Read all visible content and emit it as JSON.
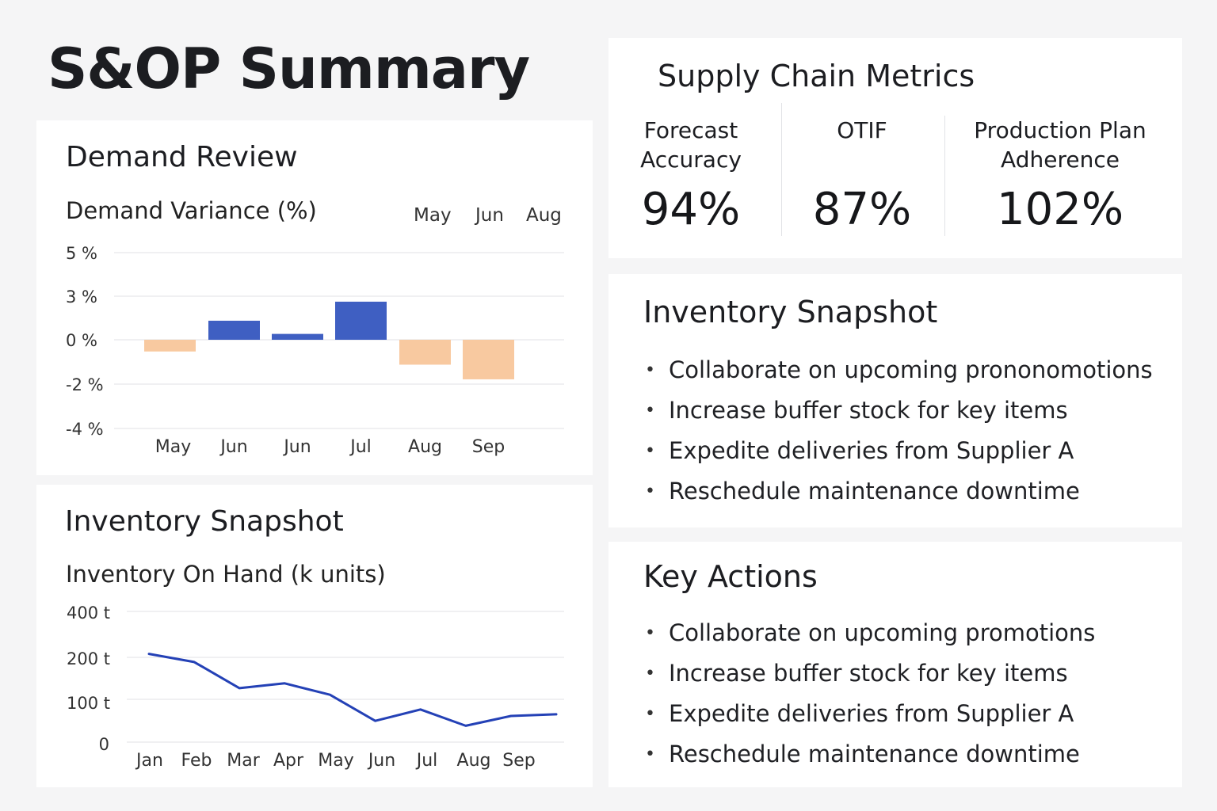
{
  "page": {
    "title": "S&OP Summary"
  },
  "demand_review": {
    "title": "Demand Review",
    "chart_title": "Demand Variance (%)",
    "header_months": [
      "May",
      "Jun",
      "Aug"
    ]
  },
  "inventory_chart_card": {
    "title": "Inventory Snapshot",
    "chart_title": "Inventory On Hand (k units)"
  },
  "metrics": {
    "title": "Supply Chain Metrics",
    "items": [
      {
        "label_line1": "Forecast",
        "label_line2": "Accuracy",
        "value": "94%"
      },
      {
        "label_line1": "OTIF",
        "label_line2": "",
        "value": "87%"
      },
      {
        "label_line1": "Production Plan",
        "label_line2": "Adherence",
        "value": "102%"
      }
    ]
  },
  "inventory_snapshot": {
    "title": "Inventory Snapshot",
    "items": [
      "Collaborate on upcoming prononomotions",
      "Increase buffer stock for key items",
      "Expedite deliveries from Supplier A",
      "Reschedule maintenance downtime"
    ]
  },
  "key_actions": {
    "title": "Key Actions",
    "items": [
      "Collaborate on upcoming promotions",
      "Increase buffer stock for key items",
      "Expedite deliveries from Supplier A",
      "Reschedule maintenance downtime"
    ]
  },
  "colors": {
    "positive_bar": "#3f5fc2",
    "negative_bar": "#f8c9a0",
    "line": "#2441b6",
    "grid": "#e1e2e5"
  },
  "chart_data": [
    {
      "type": "bar",
      "title": "Demand Variance (%)",
      "categories": [
        "May",
        "Jun",
        "Jun",
        "Jul",
        "Aug",
        "Sep"
      ],
      "values": [
        -0.8,
        1.3,
        0.4,
        2.6,
        -1.7,
        -2.7
      ],
      "y_tick_labels": [
        "5 %",
        "3 %",
        "0 %",
        "-2 %",
        "-4 %"
      ],
      "ylim": [
        -4,
        4
      ],
      "grid": true
    },
    {
      "type": "line",
      "title": "Inventory On Hand (k units)",
      "categories": [
        "Jan",
        "Feb",
        "Mar",
        "Apr",
        "May",
        "Jun",
        "Jul",
        "Aug",
        "Sep"
      ],
      "values": [
        270,
        245,
        165,
        180,
        145,
        65,
        100,
        50,
        80,
        85
      ],
      "y_tick_labels": [
        "400 t",
        "200 t",
        "100 t",
        "0"
      ],
      "grid": true
    }
  ]
}
